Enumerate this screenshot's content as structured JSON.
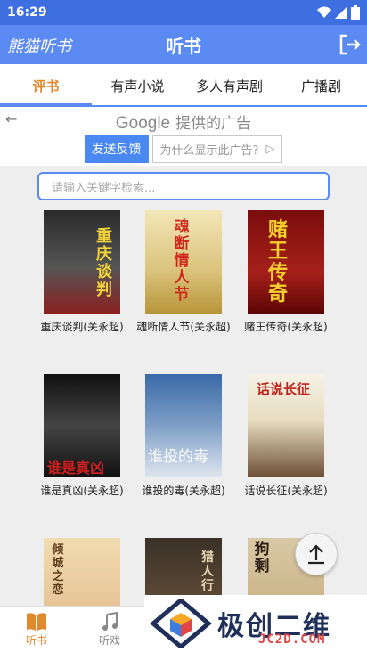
{
  "status_bar": {
    "time": "16:29"
  },
  "app_bar": {
    "brand": "熊猫听书",
    "title": "听书"
  },
  "tabs": [
    {
      "label": "评书",
      "active": true
    },
    {
      "label": "有声小说",
      "active": false
    },
    {
      "label": "多人有声剧",
      "active": false
    },
    {
      "label": "广播剧",
      "active": false
    }
  ],
  "ad": {
    "provider": "Google",
    "provided_text": "提供的广告",
    "send_feedback": "发送反馈",
    "why_this_ad": "为什么显示此广告?"
  },
  "search": {
    "placeholder": "请输入关键字检索..."
  },
  "books": [
    {
      "title": "重庆谈判(关永超)",
      "cover_text": "重庆谈判"
    },
    {
      "title": "魂断情人节(关永超)",
      "cover_text": "魂断情人节"
    },
    {
      "title": "赌王传奇(关永超)",
      "cover_text": "赌王传奇"
    },
    {
      "title": "谁是真凶(关永超)",
      "cover_text": "谁是真凶"
    },
    {
      "title": "谁投的毒(关永超)",
      "cover_text": "谁投的毒"
    },
    {
      "title": "话说长征(关永超)",
      "cover_text": "话说长征"
    },
    {
      "title": "",
      "cover_text": "倾城之恋"
    },
    {
      "title": "",
      "cover_text": "猎人行"
    },
    {
      "title": "",
      "cover_text": "狗剩"
    }
  ],
  "bottom_nav": [
    {
      "label": "听书",
      "icon": "book-icon",
      "active": true
    },
    {
      "label": "听戏",
      "icon": "music-note-icon",
      "active": false
    }
  ],
  "watermark": {
    "text": "极创二维",
    "url": "JC2D.COM"
  },
  "colors": {
    "accent": "#5b8af2",
    "active_tab": "#e0892d",
    "status_bar": "#3d6fe0"
  }
}
